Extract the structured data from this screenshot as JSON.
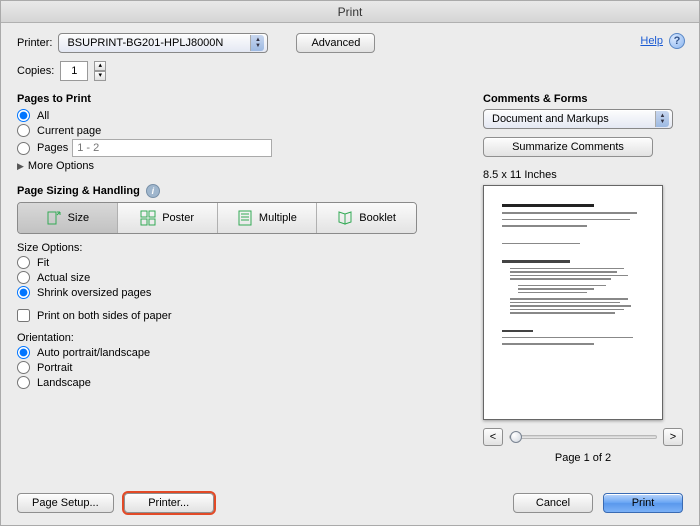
{
  "window": {
    "title": "Print"
  },
  "header": {
    "printer_label": "Printer:",
    "printer_value": "BSUPRINT-BG201-HPLJ8000N",
    "advanced": "Advanced",
    "help": "Help",
    "copies_label": "Copies:",
    "copies_value": "1"
  },
  "pages": {
    "heading": "Pages to Print",
    "all": "All",
    "current": "Current page",
    "pages_label": "Pages",
    "pages_placeholder": "1 - 2",
    "more": "More Options"
  },
  "sizing": {
    "heading": "Page Sizing & Handling",
    "seg": {
      "size": "Size",
      "poster": "Poster",
      "multiple": "Multiple",
      "booklet": "Booklet"
    },
    "size_options": "Size Options:",
    "fit": "Fit",
    "actual": "Actual size",
    "shrink": "Shrink oversized pages",
    "duplex": "Print on both sides of paper",
    "orientation_label": "Orientation:",
    "auto": "Auto portrait/landscape",
    "portrait": "Portrait",
    "landscape": "Landscape"
  },
  "comments": {
    "heading": "Comments & Forms",
    "select_value": "Document and Markups",
    "summarize": "Summarize Comments"
  },
  "preview": {
    "dims": "8.5 x 11 Inches",
    "page_of": "Page 1 of 2"
  },
  "footer": {
    "page_setup": "Page Setup...",
    "printer": "Printer...",
    "cancel": "Cancel",
    "print": "Print"
  }
}
